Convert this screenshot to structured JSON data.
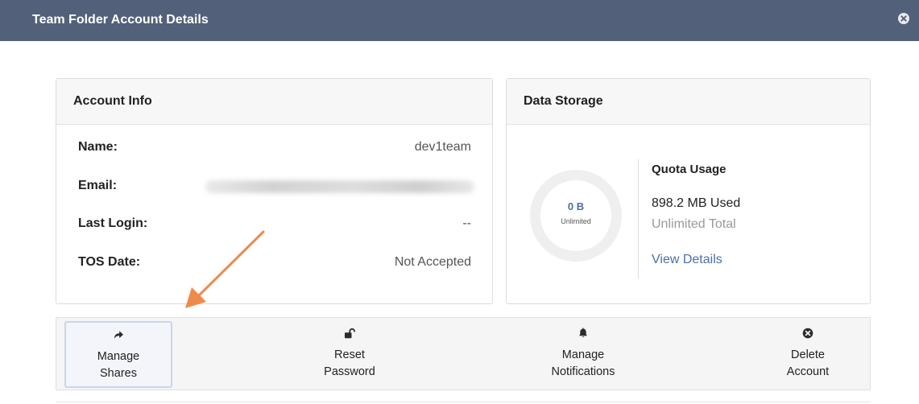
{
  "window": {
    "title": "Team Folder Account Details",
    "close_icon": "close-circle-icon"
  },
  "account_info": {
    "heading": "Account Info",
    "rows": [
      {
        "label": "Name:",
        "value": "dev1team"
      },
      {
        "label": "Email:",
        "value": ""
      },
      {
        "label": "Last Login:",
        "value": "--"
      },
      {
        "label": "TOS Date:",
        "value": "Not Accepted"
      }
    ]
  },
  "data_storage": {
    "heading": "Data Storage",
    "donut_amount": "0 B",
    "donut_sub": "Unlimited",
    "quota_title": "Quota Usage",
    "used": "898.2 MB Used",
    "total": "Unlimited Total",
    "view_details": "View Details"
  },
  "actions": [
    {
      "icon": "share-arrow-icon",
      "line1": "Manage",
      "line2": "Shares"
    },
    {
      "icon": "unlock-icon",
      "line1": "Reset",
      "line2": "Password"
    },
    {
      "icon": "bell-icon",
      "line1": "Manage",
      "line2": "Notifications"
    },
    {
      "icon": "close-circle-icon",
      "line1": "Delete",
      "line2": "Account"
    }
  ],
  "colors": {
    "titlebar": "#536079",
    "link": "#4a6fa5",
    "annotation_arrow": "#f08a4b"
  }
}
